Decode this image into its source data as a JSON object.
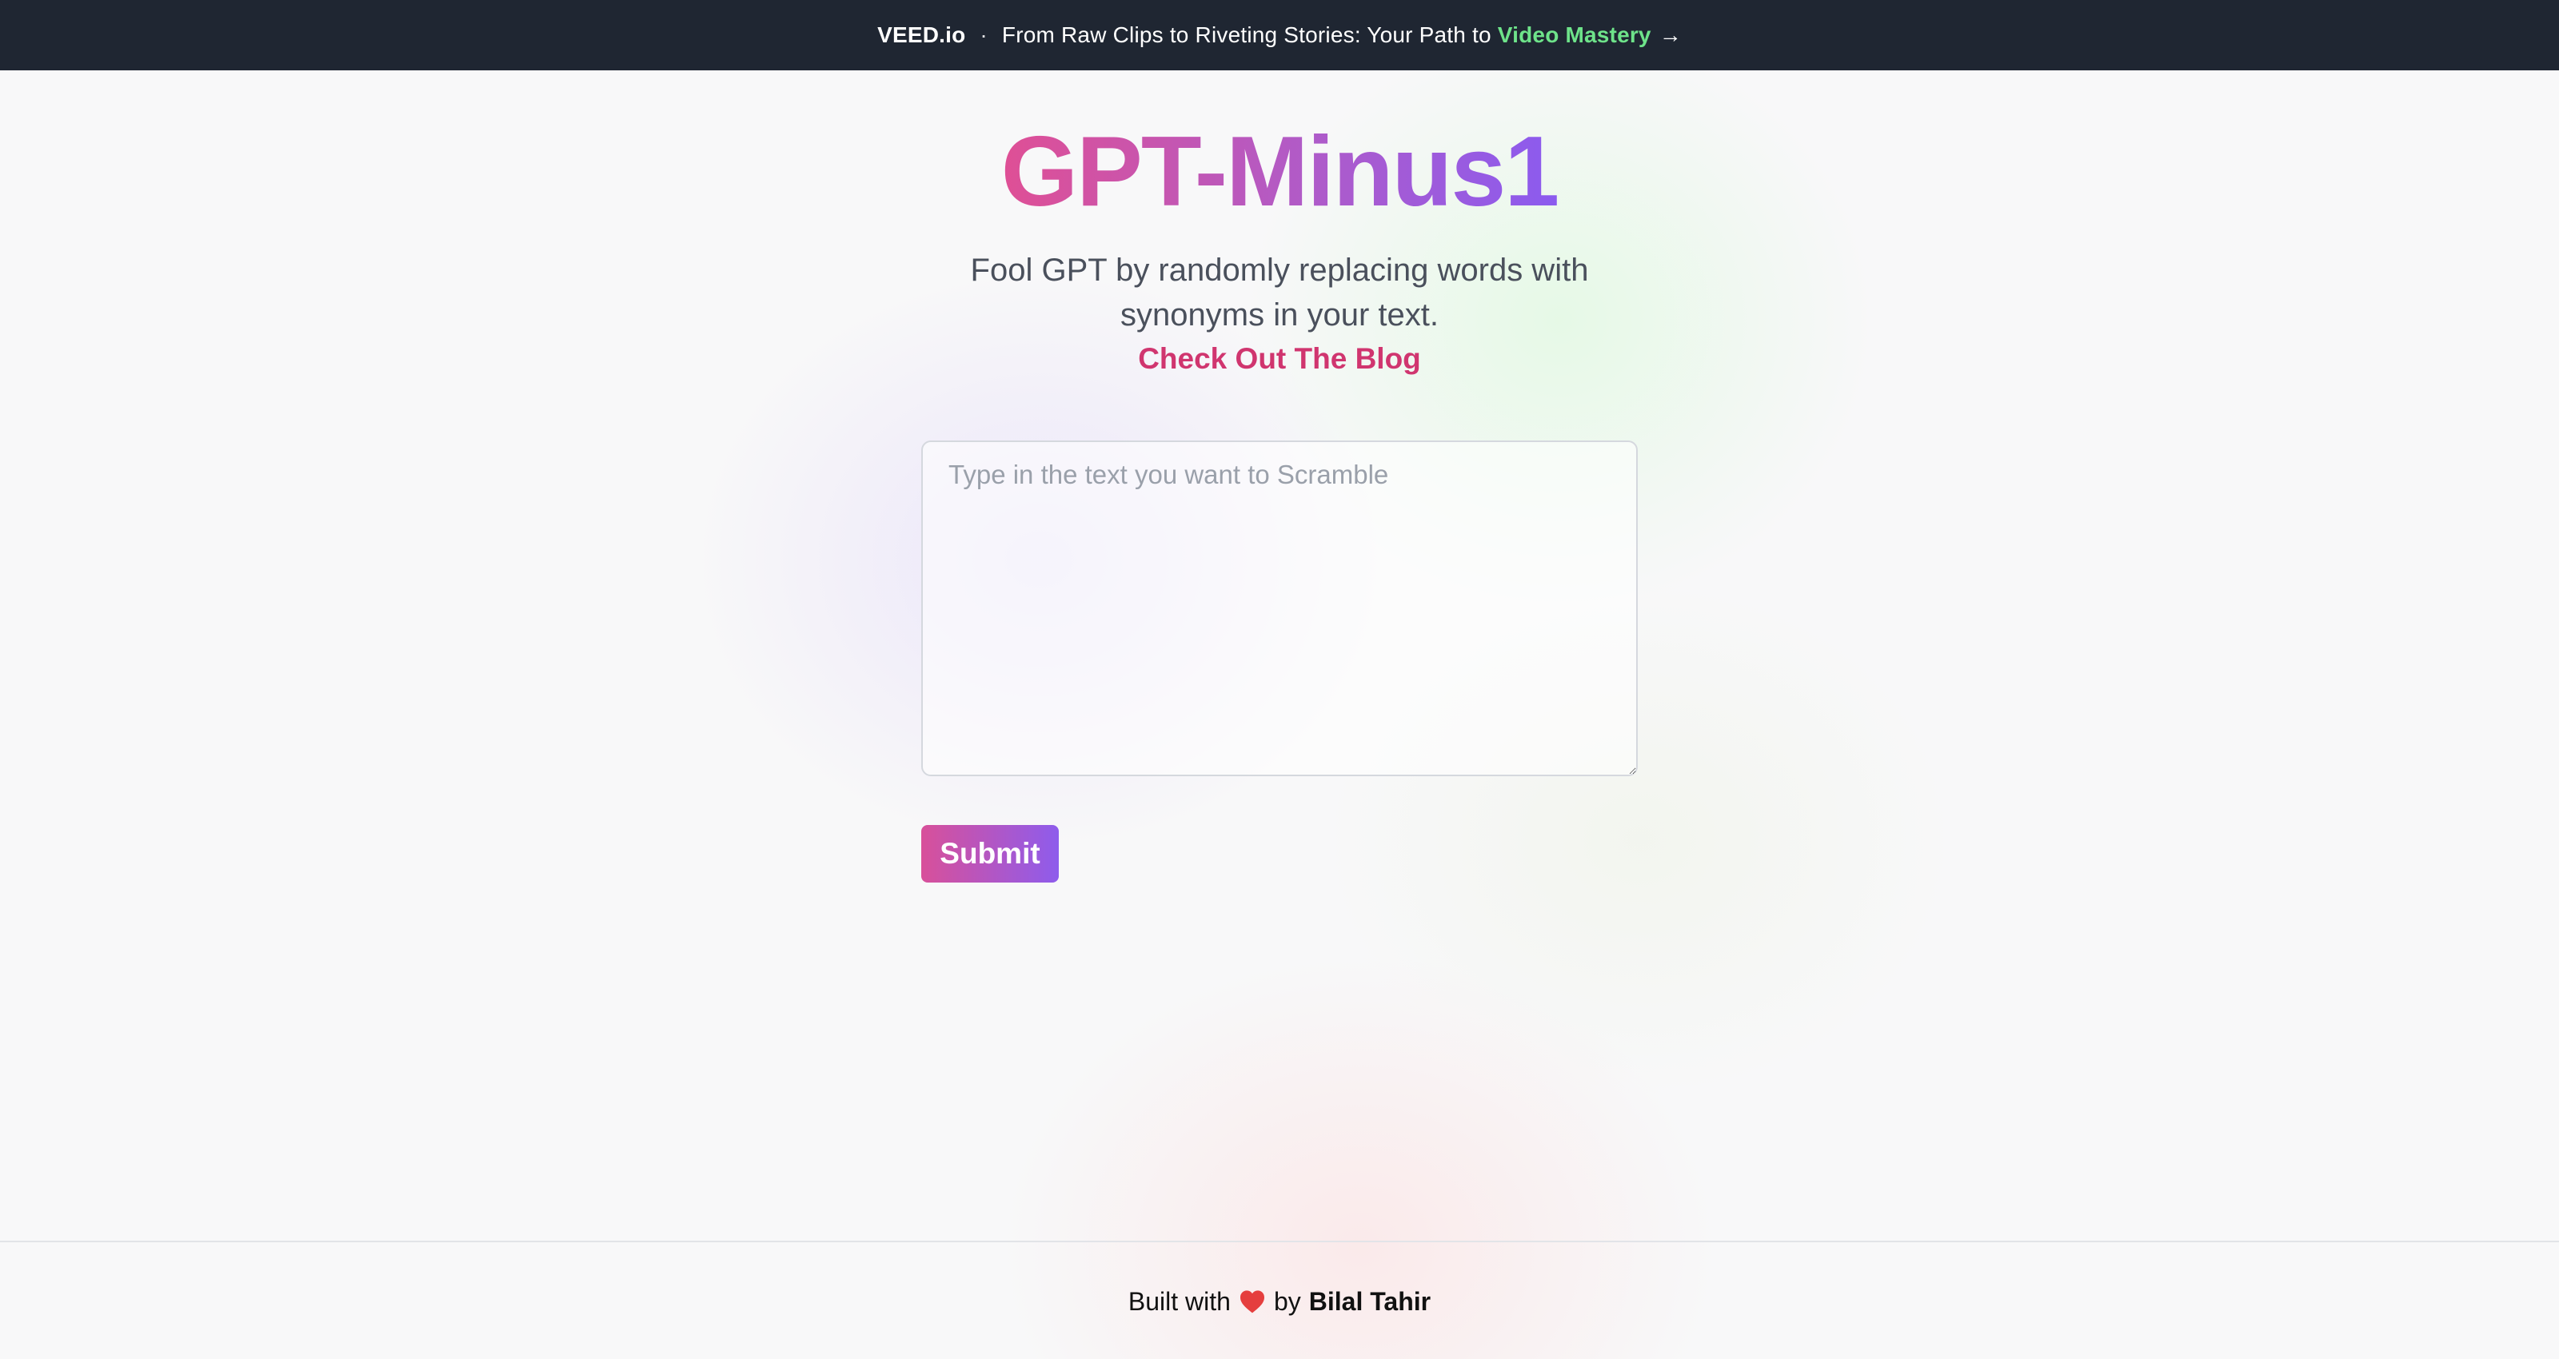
{
  "banner": {
    "brand": "VEED.io",
    "separator": "·",
    "text": "From Raw Clips to Riveting Stories: Your Path to",
    "highlight": "Video Mastery",
    "arrow": "→"
  },
  "hero": {
    "title": "GPT-Minus1",
    "subtitle": "Fool GPT by randomly replacing words with synonyms in your text.",
    "blog_link": "Check Out The Blog"
  },
  "form": {
    "placeholder": "Type in the text you want to Scramble",
    "value": "",
    "submit_label": "Submit"
  },
  "footer": {
    "built_with": "Built with",
    "by": "by",
    "author": "Bilal Tahir",
    "heart_icon": "heart-icon"
  },
  "colors": {
    "banner_bg": "#1f2632",
    "banner_accent": "#6ee38a",
    "title_gradient_start": "#df4f95",
    "title_gradient_end": "#8b5bef",
    "link": "#d0356f",
    "heart": "#e53e3e"
  }
}
